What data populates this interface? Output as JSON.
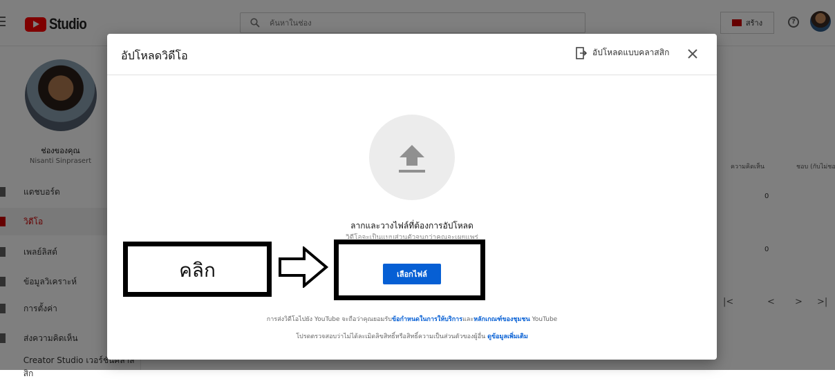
{
  "app": {
    "logo_text": "Studio"
  },
  "topbar": {
    "search_placeholder": "ค้นหาในช่อง",
    "create_label": "สร้าง",
    "help_glyph": "?"
  },
  "sidebar": {
    "channel_label": "ช่องของคุณ",
    "channel_name": "Nisanti Sinprasert",
    "items": [
      {
        "label": "แดชบอร์ด"
      },
      {
        "label": "วิดีโอ",
        "active": true
      },
      {
        "label": "เพลย์ลิสต์"
      },
      {
        "label": "ข้อมูลวิเคราะห์"
      },
      {
        "label": "การตั้งค่า"
      },
      {
        "label": "ส่งความคิดเห็น"
      },
      {
        "label": "Creator Studio เวอร์ชันคลาสสิก"
      }
    ]
  },
  "table": {
    "columns": [
      "ความคิดเห็น",
      "ชอบ (กับไม่ชอบ)"
    ],
    "rows": [
      {
        "comments": "0"
      },
      {
        "comments": "0"
      }
    ],
    "pager": [
      "|<",
      "<",
      ">",
      ">|"
    ]
  },
  "dialog": {
    "title": "อัปโหลดวิดีโอ",
    "legacy_label": "อัปโหลดแบบคลาสสิก",
    "drag_text": "ลากและวางไฟล์ที่ต้องการอัปโหลด",
    "drag_subtext": "วิดีโอจะเป็นแบบส่วนตัวจนกว่าคุณจะเผยแพร่",
    "select_button": "เลือกไฟล์",
    "terms_prefix": "การส่งวิดีโอไปยัง YouTube จะถือว่าคุณยอมรับ",
    "terms_link1": "ข้อกำหนดในการให้บริการ",
    "terms_and": "และ",
    "terms_link2": "หลักเกณฑ์ของชุมชน",
    "terms_suffix": " YouTube",
    "rights_text": "โปรดตรวจสอบว่าไม่ได้ละเมิดลิขสิทธิ์หรือสิทธิ์ความเป็นส่วนตัวของผู้อื่น ",
    "learn_more": "ดูข้อมูลเพิ่มเติม"
  },
  "annotation": {
    "label": "คลิก"
  },
  "colors": {
    "accent": "#065fd4",
    "brand_red": "#ff0000",
    "active_red": "#cc0000"
  }
}
